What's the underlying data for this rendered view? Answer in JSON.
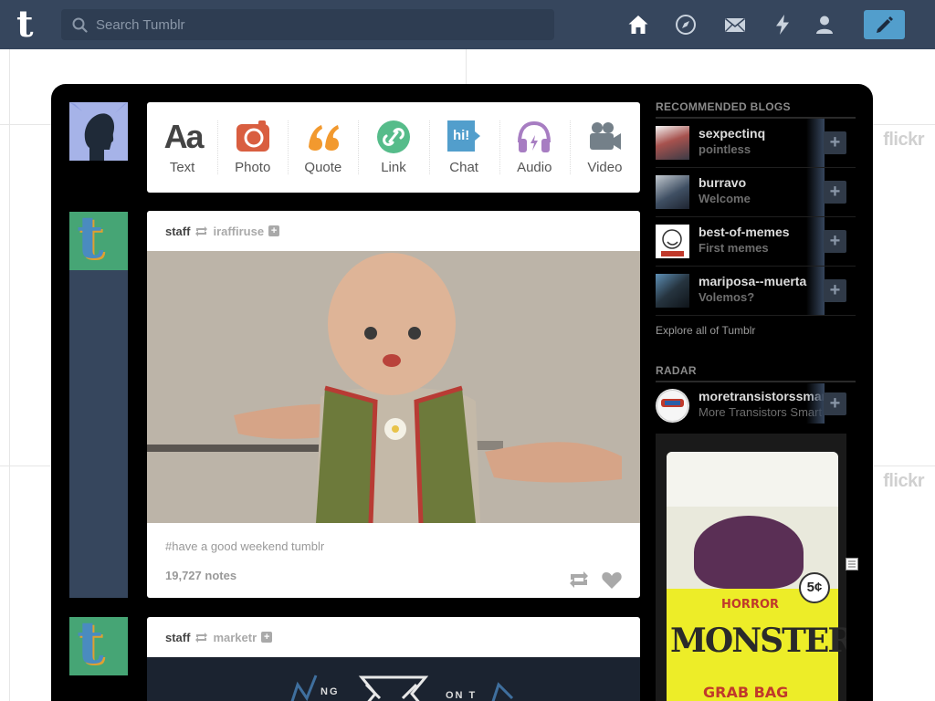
{
  "topbar": {
    "logo": "t",
    "search_placeholder": "Search Tumblr",
    "icons": [
      "home-icon",
      "explore-icon",
      "inbox-icon",
      "activity-icon",
      "account-icon",
      "compose-icon"
    ],
    "colors": {
      "bar": "#36465d",
      "compose": "#529ecc"
    }
  },
  "background": {
    "watermark": "flickr"
  },
  "post_types": [
    {
      "label": "Text",
      "icon": "text-icon",
      "glyph": "Aa",
      "color": "#444444"
    },
    {
      "label": "Photo",
      "icon": "camera-icon",
      "color": "#d95e40"
    },
    {
      "label": "Quote",
      "icon": "quote-icon",
      "color": "#f2992e"
    },
    {
      "label": "Link",
      "icon": "link-icon",
      "color": "#56bc8a"
    },
    {
      "label": "Chat",
      "icon": "chat-icon",
      "glyph": "hi!",
      "color": "#529ecc"
    },
    {
      "label": "Audio",
      "icon": "headphones-icon",
      "color": "#a77dc2"
    },
    {
      "label": "Video",
      "icon": "video-camera-icon",
      "color": "#748089"
    }
  ],
  "posts": [
    {
      "author": "staff",
      "reblogged_from": "iraffiruse",
      "tags": "#have a good weekend tumblr",
      "notes": "19,727 notes"
    },
    {
      "author": "staff",
      "reblogged_from": "marketr",
      "image_text": [
        "NG",
        "ON T"
      ]
    }
  ],
  "recommended": {
    "title": "RECOMMENDED BLOGS",
    "blogs": [
      {
        "name": "sexpectinq",
        "tagline": "pointless"
      },
      {
        "name": "burravo",
        "tagline": "Welcome"
      },
      {
        "name": "best-of-memes",
        "tagline": "First memes"
      },
      {
        "name": "mariposa--muerta",
        "tagline": "Volemos?"
      }
    ],
    "explore": "Explore all of Tumblr"
  },
  "radar": {
    "title": "RADAR",
    "blog": {
      "name": "moretransistorssmart",
      "tagline": "More Transistors Smart"
    },
    "image": {
      "horror": "HORROR",
      "monsters": "MONSTERS",
      "price": "5¢",
      "bag": "GRAB BAG"
    }
  }
}
